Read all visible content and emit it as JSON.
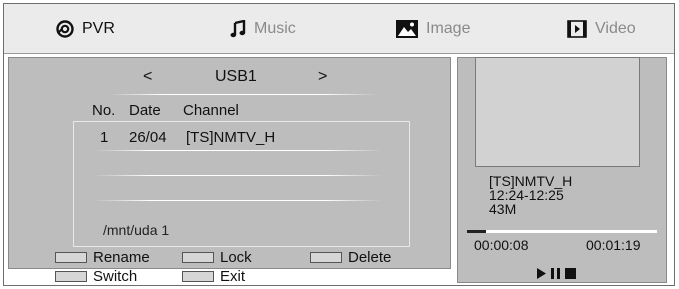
{
  "tabs": [
    {
      "label": "PVR",
      "icon": "pvr-icon",
      "active": true
    },
    {
      "label": "Music",
      "icon": "music-note-icon",
      "active": false
    },
    {
      "label": "Image",
      "icon": "image-icon",
      "active": false
    },
    {
      "label": "Video",
      "icon": "video-icon",
      "active": false
    }
  ],
  "device": {
    "name": "USB1",
    "prev": "<",
    "next": ">"
  },
  "table": {
    "columns": [
      "No.",
      "Date",
      "Channel"
    ],
    "rows": [
      {
        "no": "1",
        "date": "26/04",
        "channel": "[TS]NMTV_H"
      }
    ]
  },
  "path": "/mnt/uda 1",
  "keys": [
    {
      "label": "Rename",
      "color": "#d6d6d6"
    },
    {
      "label": "Lock",
      "color": "#d6d6d6"
    },
    {
      "label": "Delete",
      "color": "#d6d6d6"
    },
    {
      "label": "Switch",
      "color": "#d6d6d6"
    },
    {
      "label": "Exit",
      "color": "#d6d6d6"
    }
  ],
  "info": {
    "channel": "[TS]NMTV_H",
    "time_range": "12:24-12:25",
    "size": "43M"
  },
  "playback": {
    "elapsed": "00:00:08",
    "total": "00:01:19",
    "progress": 0.1
  },
  "controls": [
    "play-icon",
    "pause-icon",
    "stop-icon"
  ]
}
